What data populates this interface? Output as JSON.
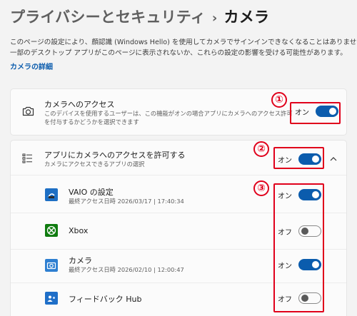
{
  "breadcrumb": {
    "parent": "プライバシーとセキュリティ",
    "separator": "›",
    "current": "カメラ"
  },
  "description": {
    "line1": "このページの設定により、顔認識 (Windows Hello) を使用してカメラでサインインできなくなることはありません。",
    "line2": "一部のデスクトップ アプリがこのページに表示されないか、これらの設定の影響を受ける可能性があります。",
    "link": "カメラの詳細"
  },
  "camera_access": {
    "icon": "camera-icon",
    "title": "カメラへのアクセス",
    "subtitle_line1": "このデバイスを使用するユーザーは、この機能がオンの場合アプリにカメラへのアクセス許可",
    "subtitle_line2": "を付与するかどうかを選択できます",
    "toggle_label": "オン",
    "toggle_state": "on"
  },
  "app_access": {
    "icon": "list-icon",
    "title": "アプリにカメラへのアクセスを許可する",
    "subtitle": "カメラにアクセスできるアプリの選択",
    "toggle_label": "オン",
    "toggle_state": "on",
    "expand_icon": "chevron-up-icon"
  },
  "apps": [
    {
      "name": "VAIO の設定",
      "last_access": "最終アクセス日時 2026/03/17 | 17:40:34",
      "toggle_label": "オン",
      "toggle_state": "on",
      "icon": "vaio-settings-icon"
    },
    {
      "name": "Xbox",
      "last_access": "",
      "toggle_label": "オフ",
      "toggle_state": "off",
      "icon": "xbox-icon"
    },
    {
      "name": "カメラ",
      "last_access": "最終アクセス日時 2026/02/10 | 12:00:47",
      "toggle_label": "オン",
      "toggle_state": "on",
      "icon": "camera-app-icon"
    },
    {
      "name": "フィードバック Hub",
      "last_access": "",
      "toggle_label": "オフ",
      "toggle_state": "off",
      "icon": "feedback-hub-icon"
    }
  ],
  "annotations": [
    "①",
    "②",
    "③"
  ],
  "colors": {
    "accent": "#0b5cad",
    "annotation": "#e0001b"
  }
}
